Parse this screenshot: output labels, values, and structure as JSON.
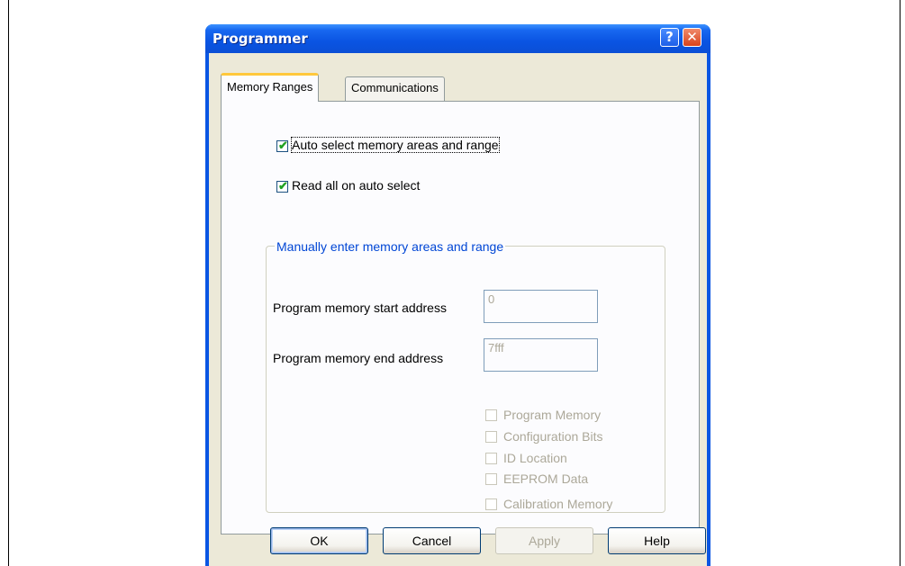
{
  "window": {
    "title": "Programmer",
    "help_glyph": "?",
    "close_glyph": "✕"
  },
  "tabs": [
    {
      "label": "Memory Ranges",
      "active": true
    },
    {
      "label": "Communications",
      "active": false
    }
  ],
  "options": {
    "auto_select": {
      "label": "Auto select memory areas and range",
      "checked": true
    },
    "read_all": {
      "label": "Read all on auto select",
      "checked": true
    }
  },
  "manual": {
    "group_title": "Manually enter memory areas and range",
    "start_label": "Program memory start address",
    "start_value": "0",
    "end_label": "Program memory end address",
    "end_value": "7fff",
    "areas": [
      {
        "label": "Program Memory",
        "checked": false
      },
      {
        "label": "Configuration Bits",
        "checked": false
      },
      {
        "label": "ID Location",
        "checked": false
      },
      {
        "label": "EEPROM Data",
        "checked": false
      },
      {
        "label": "Calibration Memory",
        "checked": false
      }
    ]
  },
  "buttons": {
    "ok": "OK",
    "cancel": "Cancel",
    "apply": "Apply",
    "help": "Help"
  },
  "colors": {
    "titlebar": "#0a54e2",
    "group_title": "#0046d5",
    "check": "#21a121",
    "tab_highlight": "#ffc83c"
  }
}
